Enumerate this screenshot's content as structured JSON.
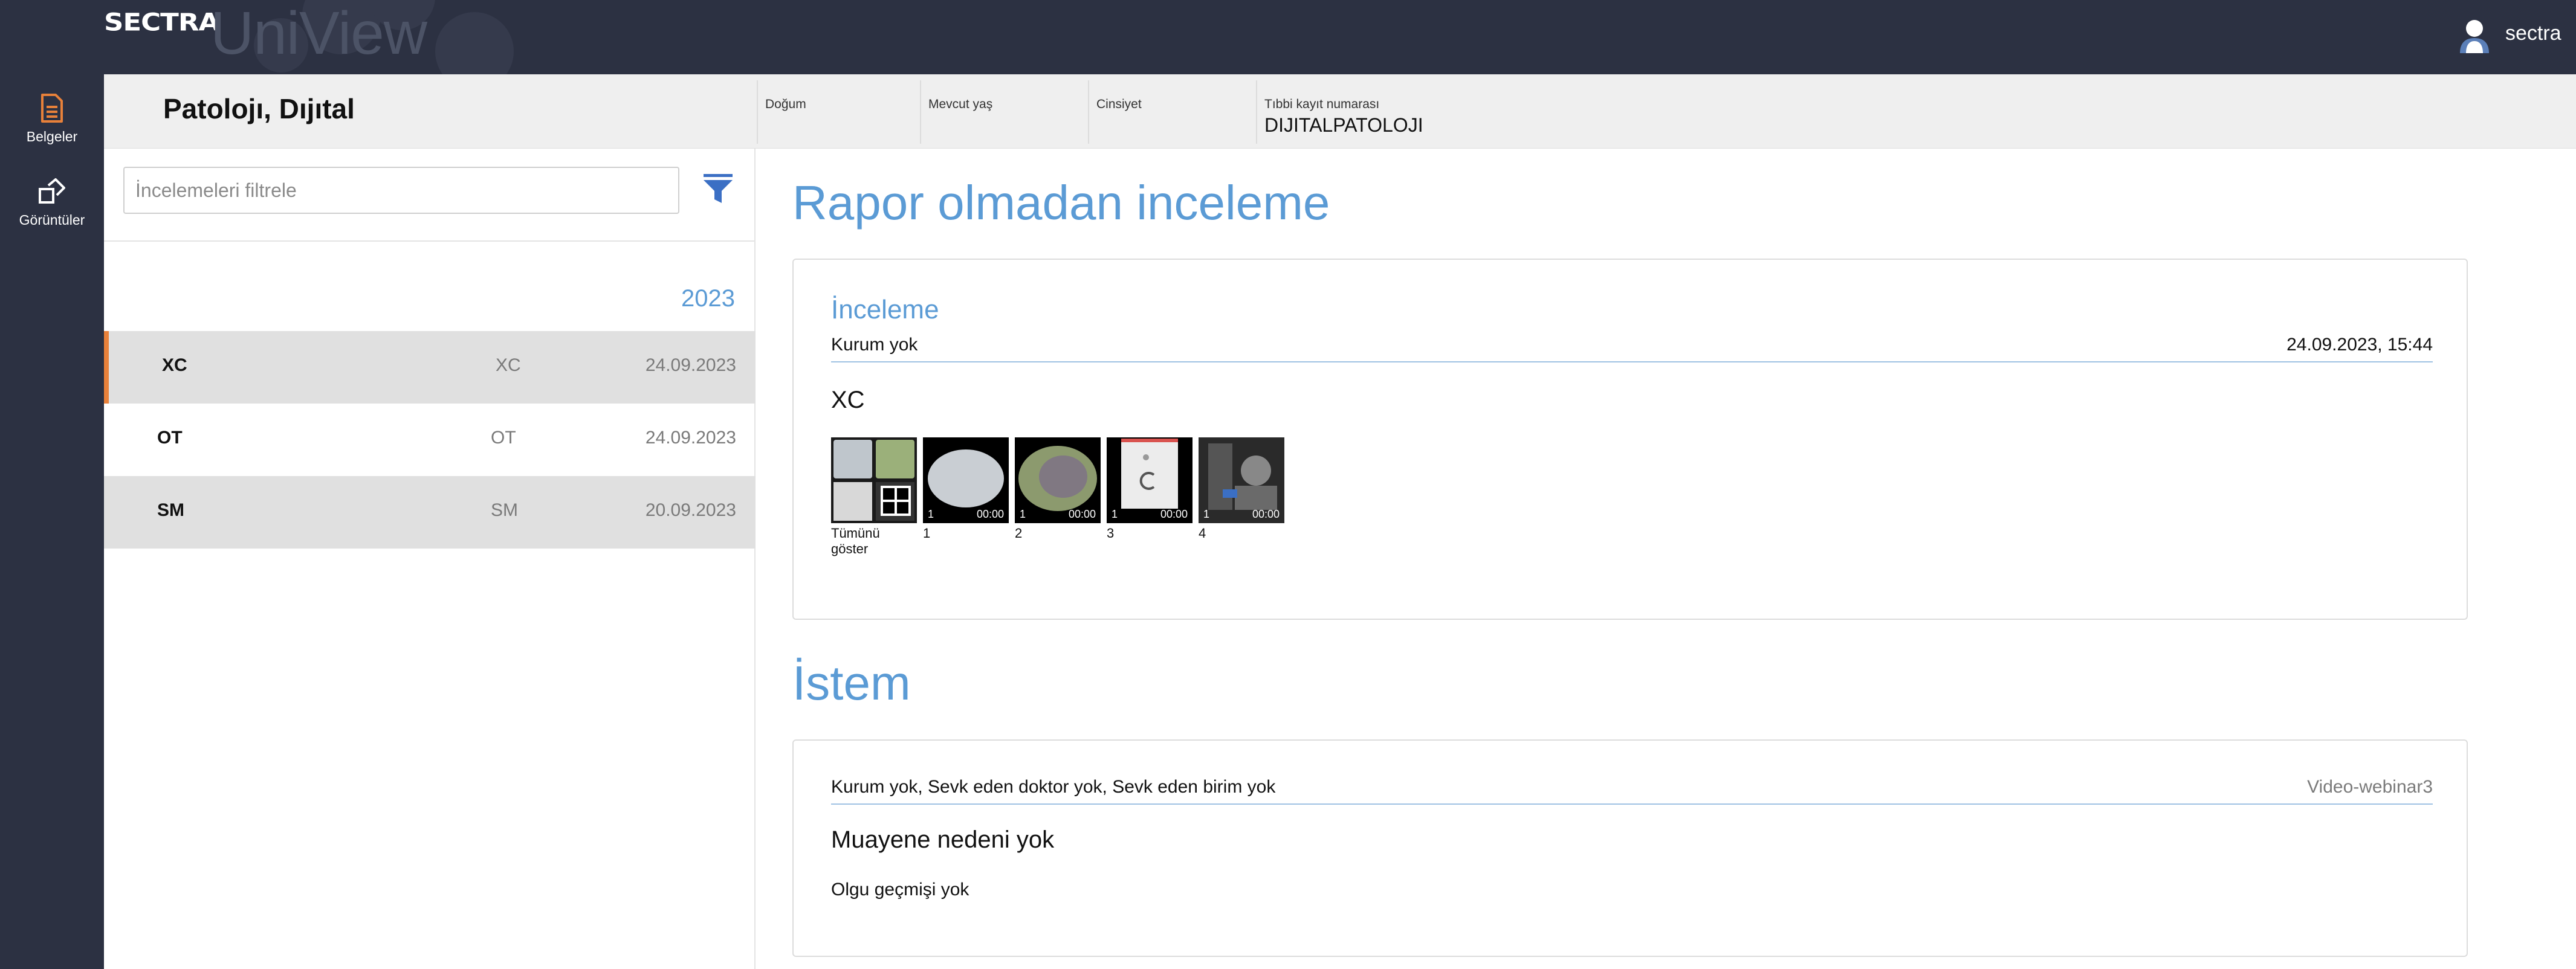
{
  "app": {
    "brand_name": "SECTRA",
    "product_name": "UniView",
    "user": "sectra"
  },
  "nav": {
    "items": [
      {
        "label": "Belgeler",
        "icon": "document-icon",
        "active": true
      },
      {
        "label": "Görüntüler",
        "icon": "images-icon",
        "active": false
      }
    ]
  },
  "patient": {
    "name": "Patolojı, Dıjıtal",
    "fields": [
      {
        "label": "Doğum",
        "value": ""
      },
      {
        "label": "Mevcut yaş",
        "value": ""
      },
      {
        "label": "Cinsiyet",
        "value": ""
      },
      {
        "label": "Tıbbi kayıt numarası",
        "value": "DIJITALPATOLOJI"
      }
    ]
  },
  "exam_list": {
    "filter_placeholder": "İncelemeleri filtrele",
    "year": "2023",
    "rows": [
      {
        "code": "XC",
        "modality": "XC",
        "date": "24.09.2023",
        "selected": true
      },
      {
        "code": "OT",
        "modality": "OT",
        "date": "24.09.2023",
        "selected": false
      },
      {
        "code": "SM",
        "modality": "SM",
        "date": "20.09.2023",
        "selected": false
      }
    ]
  },
  "report": {
    "title": "Rapor olmadan inceleme",
    "exam": {
      "heading": "İnceleme",
      "institution": "Kurum yok",
      "datetime": "24.09.2023, 15:44",
      "modality": "XC",
      "show_all_label": "Tümünü göster",
      "thumbnails": [
        {
          "label": "1",
          "count": "1",
          "duration": "00:00"
        },
        {
          "label": "2",
          "count": "1",
          "duration": "00:00"
        },
        {
          "label": "3",
          "count": "1",
          "duration": "00:00"
        },
        {
          "label": "4",
          "count": "1",
          "duration": "00:00"
        }
      ]
    }
  },
  "request": {
    "title": "İstem",
    "info": "Kurum yok, Sevk eden doktor yok, Sevk eden birim yok",
    "source": "Video-webinar3",
    "reason": "Muayene nedeni yok",
    "history": "Olgu geçmişi yok"
  },
  "colors": {
    "topbar": "#2c3142",
    "accent_blue": "#5b9bd5",
    "selected_marker": "#e8813a",
    "nav_icon": "#e8813a"
  }
}
